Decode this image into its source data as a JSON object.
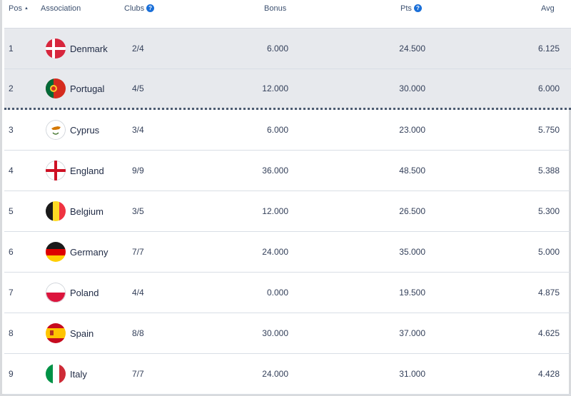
{
  "headers": {
    "pos": "Pos",
    "association": "Association",
    "clubs": "Clubs",
    "bonus": "Bonus",
    "pts": "Pts",
    "avg": "Avg",
    "help_glyph": "?",
    "sort_glyph": "▲"
  },
  "rows": [
    {
      "pos": "1",
      "name": "Denmark",
      "clubs": "2/4",
      "bonus": "6.000",
      "pts": "24.500",
      "avg": "6.125",
      "flag": "denmark-flag-icon"
    },
    {
      "pos": "2",
      "name": "Portugal",
      "clubs": "4/5",
      "bonus": "12.000",
      "pts": "30.000",
      "avg": "6.000",
      "flag": "portugal-flag-icon"
    },
    {
      "pos": "3",
      "name": "Cyprus",
      "clubs": "3/4",
      "bonus": "6.000",
      "pts": "23.000",
      "avg": "5.750",
      "flag": "cyprus-flag-icon"
    },
    {
      "pos": "4",
      "name": "England",
      "clubs": "9/9",
      "bonus": "36.000",
      "pts": "48.500",
      "avg": "5.388",
      "flag": "england-flag-icon"
    },
    {
      "pos": "5",
      "name": "Belgium",
      "clubs": "3/5",
      "bonus": "12.000",
      "pts": "26.500",
      "avg": "5.300",
      "flag": "belgium-flag-icon"
    },
    {
      "pos": "6",
      "name": "Germany",
      "clubs": "7/7",
      "bonus": "24.000",
      "pts": "35.000",
      "avg": "5.000",
      "flag": "germany-flag-icon"
    },
    {
      "pos": "7",
      "name": "Poland",
      "clubs": "4/4",
      "bonus": "0.000",
      "pts": "19.500",
      "avg": "4.875",
      "flag": "poland-flag-icon"
    },
    {
      "pos": "8",
      "name": "Spain",
      "clubs": "8/8",
      "bonus": "30.000",
      "pts": "37.000",
      "avg": "4.625",
      "flag": "spain-flag-icon"
    },
    {
      "pos": "9",
      "name": "Italy",
      "clubs": "7/7",
      "bonus": "24.000",
      "pts": "31.000",
      "avg": "4.428",
      "flag": "italy-flag-icon"
    }
  ],
  "colors": {
    "highlight_row": "#e7e9ed",
    "help_badge": "#1a6fd8",
    "qualification_line": "#4b5a70"
  }
}
